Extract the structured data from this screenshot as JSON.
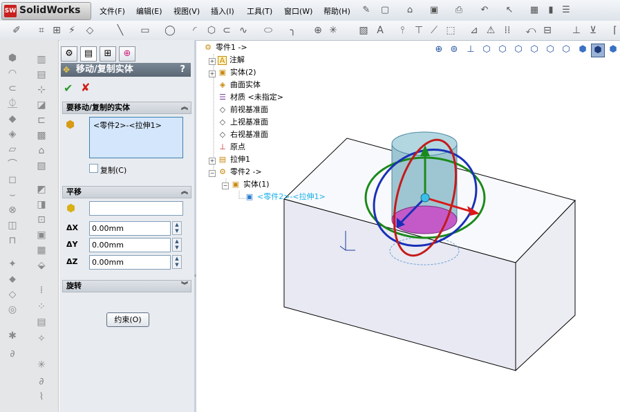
{
  "app": {
    "logo_badge": "SW",
    "name": "SolidWorks"
  },
  "menu": [
    "文件(F)",
    "编辑(E)",
    "视图(V)",
    "插入(I)",
    "工具(T)",
    "窗口(W)",
    "帮助(H)"
  ],
  "property_manager": {
    "title": "移动/复制实体",
    "help": "?",
    "ok_icon": "check-icon",
    "cancel_icon": "x-icon",
    "groups": {
      "bodies": {
        "title": "要移动/复制的实体",
        "selected": "<零件2>-<拉伸1>",
        "copy_label": "复制(C)"
      },
      "translate": {
        "title": "平移",
        "ref_value": "",
        "dx_label": "X",
        "dy_label": "Y",
        "dz_label": "Z",
        "dx": "0.00mm",
        "dy": "0.00mm",
        "dz": "0.00mm"
      },
      "rotate": {
        "title": "旋转"
      }
    },
    "constraints_button": "约束(O)"
  },
  "tree": [
    {
      "label": "零件1 ->",
      "indent": 0,
      "icon": "part-icon"
    },
    {
      "label": "注解",
      "indent": 1,
      "icon": "annotation-icon"
    },
    {
      "label": "实体(2)",
      "indent": 1,
      "icon": "solid-bodies-icon"
    },
    {
      "label": "曲面实体",
      "indent": 1,
      "icon": "surface-bodies-icon"
    },
    {
      "label": "材质 <未指定>",
      "indent": 1,
      "icon": "material-icon"
    },
    {
      "label": "前视基准面",
      "indent": 1,
      "icon": "plane-icon"
    },
    {
      "label": "上视基准面",
      "indent": 1,
      "icon": "plane-icon"
    },
    {
      "label": "右视基准面",
      "indent": 1,
      "icon": "plane-icon"
    },
    {
      "label": "原点",
      "indent": 1,
      "icon": "origin-icon"
    },
    {
      "label": "拉伸1",
      "indent": 1,
      "icon": "extrude-icon"
    },
    {
      "label": "零件2 ->",
      "indent": 1,
      "icon": "part-icon"
    },
    {
      "label": "实体(1)",
      "indent": 2,
      "icon": "solid-bodies-icon"
    },
    {
      "label": "<零件2>-<拉伸1>",
      "indent": 3,
      "icon": "body-icon",
      "selected": true
    }
  ]
}
